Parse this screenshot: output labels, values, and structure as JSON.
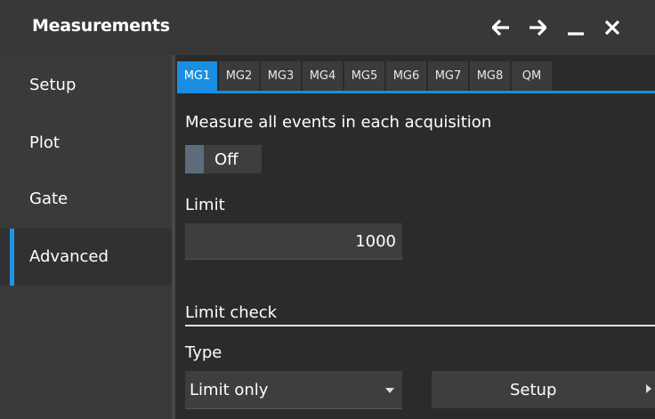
{
  "window": {
    "title": "Measurements"
  },
  "titlebar_icons": [
    "arrow-left-icon",
    "arrow-right-icon",
    "minimize-icon",
    "close-icon"
  ],
  "sidebar": {
    "items": [
      {
        "label": "Setup",
        "active": false
      },
      {
        "label": "Plot",
        "active": false
      },
      {
        "label": "Gate",
        "active": false
      },
      {
        "label": "Advanced",
        "active": true
      }
    ]
  },
  "tabs": [
    {
      "label": "MG1",
      "active": true
    },
    {
      "label": "MG2",
      "active": false
    },
    {
      "label": "MG3",
      "active": false
    },
    {
      "label": "MG4",
      "active": false
    },
    {
      "label": "MG5",
      "active": false
    },
    {
      "label": "MG6",
      "active": false
    },
    {
      "label": "MG7",
      "active": false
    },
    {
      "label": "MG8",
      "active": false
    },
    {
      "label": "QM",
      "active": false
    }
  ],
  "main": {
    "measure_all_label": "Measure all events in each acquisition",
    "measure_all_toggle": "Off",
    "limit_label": "Limit",
    "limit_value": "1000",
    "limit_check_heading": "Limit check",
    "type_label": "Type",
    "type_value": "Limit only",
    "setup_button": "Setup"
  },
  "colors": {
    "accent": "#1a8ee0",
    "background": "#2b2b2b",
    "panel": "#3e3e3e"
  }
}
